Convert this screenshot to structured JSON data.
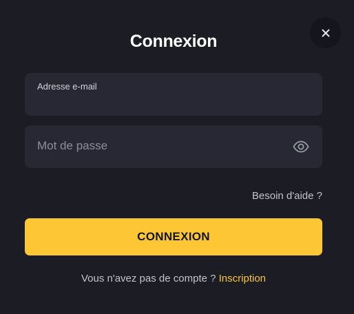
{
  "modal": {
    "title": "Connexion",
    "close_icon": "close-icon"
  },
  "form": {
    "email": {
      "label": "Adresse e-mail",
      "value": ""
    },
    "password": {
      "placeholder": "Mot de passe",
      "value": "",
      "toggle_icon": "eye-icon"
    },
    "help_link": "Besoin d'aide ?",
    "submit_label": "CONNEXION"
  },
  "footer": {
    "prompt": "Vous n'avez pas de compte ? ",
    "signup_link": "Inscription"
  },
  "colors": {
    "background": "#1c1d24",
    "field_background": "#272833",
    "accent": "#fcc634",
    "text": "#ffffff",
    "muted_text": "#c3c4cb"
  }
}
